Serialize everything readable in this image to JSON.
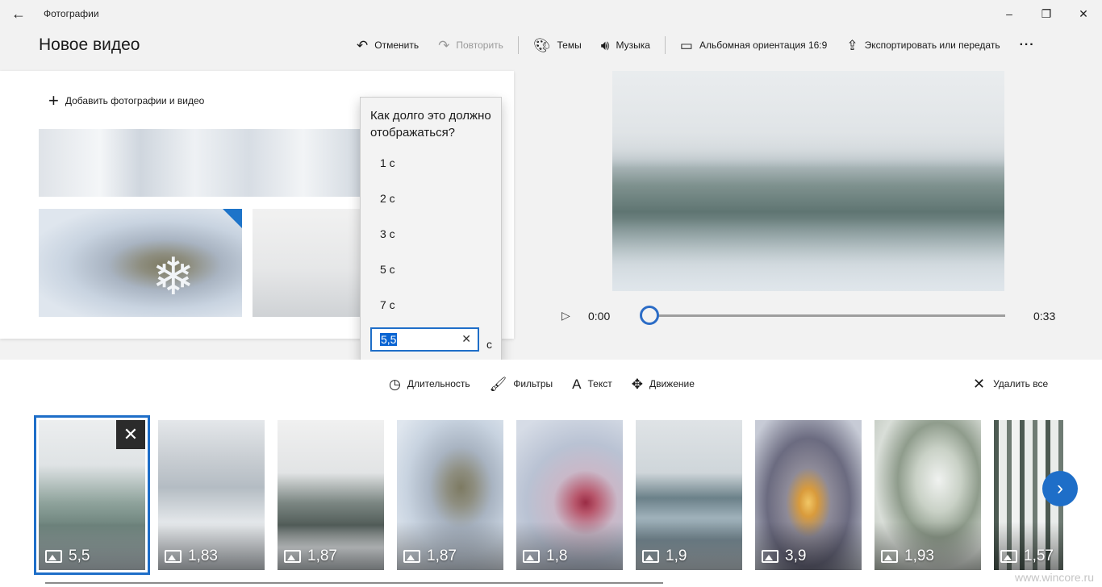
{
  "window": {
    "app_title": "Фотографии",
    "controls": {
      "minimize": "–",
      "restore": "❐",
      "close": "✕"
    }
  },
  "page_title": "Новое видео",
  "toolbar": {
    "undo": "Отменить",
    "redo": "Повторить",
    "themes": "Темы",
    "music": "Музыка",
    "orientation": "Альбомная ориентация 16:9",
    "export": "Экспортировать или передать",
    "more": "···"
  },
  "library": {
    "add_label": "Добавить фотографии и видео"
  },
  "duration_flyout": {
    "question": "Как долго это должно отображаться?",
    "options": [
      "1 с",
      "2 с",
      "3 с",
      "5 с",
      "7 с"
    ],
    "input_value": "5,5",
    "unit": "с"
  },
  "playback": {
    "current_time": "0:00",
    "total_time": "0:33",
    "progress": 0
  },
  "storyboard_toolbar": {
    "duration": "Длительность",
    "filters": "Фильтры",
    "text": "Текст",
    "motion": "Движение",
    "delete_all": "Удалить все"
  },
  "storyboard": {
    "cards": [
      {
        "duration": "5,5",
        "selected": true
      },
      {
        "duration": "1,83"
      },
      {
        "duration": "1,87"
      },
      {
        "duration": "1,87"
      },
      {
        "duration": "1,8"
      },
      {
        "duration": "1,9"
      },
      {
        "duration": "3,9"
      },
      {
        "duration": "1,93"
      },
      {
        "duration": "1,57"
      }
    ]
  },
  "watermark": "www.wincore.ru",
  "colors": {
    "accent": "#1e6ec8"
  }
}
